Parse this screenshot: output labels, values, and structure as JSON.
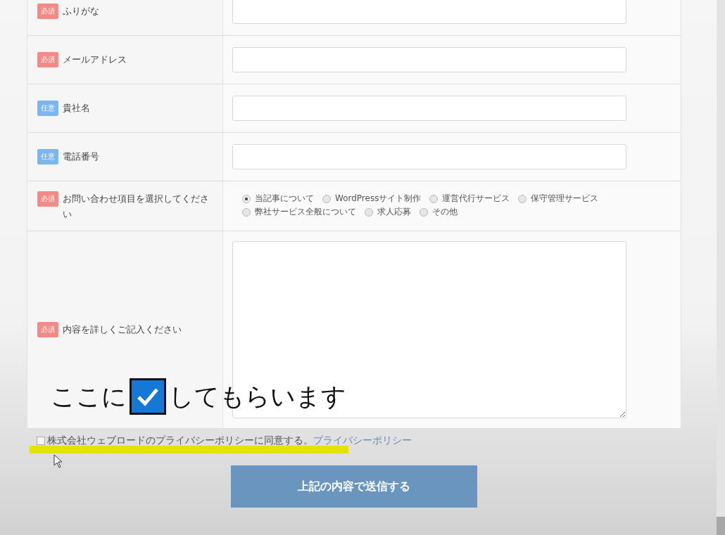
{
  "form": {
    "rows": [
      {
        "kind": "text",
        "badge": {
          "text": "必須",
          "color": "#f28b85"
        },
        "label": "ふりがな"
      },
      {
        "kind": "text",
        "badge": {
          "text": "必須",
          "color": "#f28b85"
        },
        "label": "メールアドレス"
      },
      {
        "kind": "text",
        "badge": {
          "text": "任意",
          "color": "#7cb6ee"
        },
        "label": "貴社名"
      },
      {
        "kind": "text",
        "badge": {
          "text": "任意",
          "color": "#7cb6ee"
        },
        "label": "電話番号"
      },
      {
        "kind": "radio",
        "badge": {
          "text": "必須",
          "color": "#f28b85"
        },
        "label": "お問い合わせ項目を選択してください",
        "options": [
          {
            "label": "当記事について",
            "selected": true
          },
          {
            "label": "WordPressサイト制作",
            "selected": false
          },
          {
            "label": "運営代行サービス",
            "selected": false
          },
          {
            "label": "保守管理サービス",
            "selected": false
          },
          {
            "label": "弊社サービス全般について",
            "selected": false
          },
          {
            "label": "求人応募",
            "selected": false
          },
          {
            "label": "その他",
            "selected": false
          }
        ]
      },
      {
        "kind": "textarea",
        "badge": {
          "text": "必須",
          "color": "#f28b85"
        },
        "label": "内容を詳しくご記入ください"
      }
    ]
  },
  "caption": {
    "before": "ここに",
    "after": "してもらいます"
  },
  "consent": {
    "checked": false,
    "text": "株式会社ウェブロードのプライバシーポリシーに同意する。",
    "link": "プライバシーポリシー"
  },
  "submit": "上記の内容で送信する"
}
